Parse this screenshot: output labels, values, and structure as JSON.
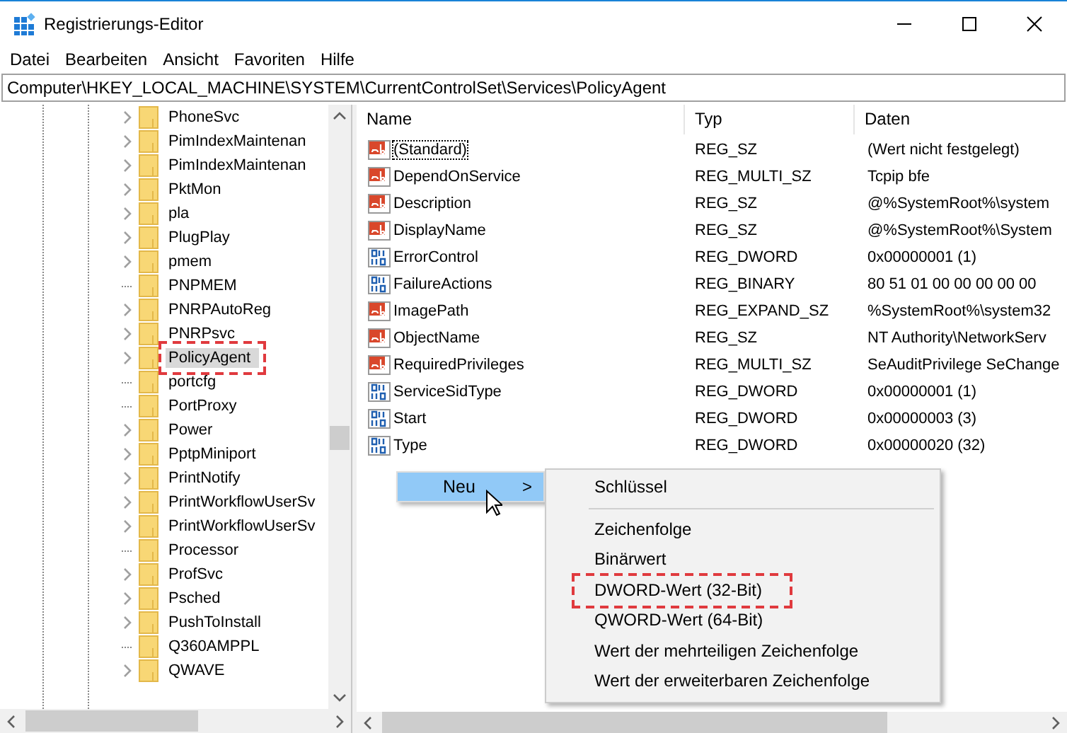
{
  "window": {
    "title": "Registrierungs-Editor"
  },
  "menu": [
    "Datei",
    "Bearbeiten",
    "Ansicht",
    "Favoriten",
    "Hilfe"
  ],
  "address": "Computer\\HKEY_LOCAL_MACHINE\\SYSTEM\\CurrentControlSet\\Services\\PolicyAgent",
  "tree": [
    {
      "label": "PhoneSvc",
      "kind": "arrow",
      "selected": false,
      "marked": false
    },
    {
      "label": "PimIndexMaintenan",
      "kind": "arrow",
      "selected": false,
      "marked": false
    },
    {
      "label": "PimIndexMaintenan",
      "kind": "arrow",
      "selected": false,
      "marked": false
    },
    {
      "label": "PktMon",
      "kind": "arrow",
      "selected": false,
      "marked": false
    },
    {
      "label": "pla",
      "kind": "arrow",
      "selected": false,
      "marked": false
    },
    {
      "label": "PlugPlay",
      "kind": "arrow",
      "selected": false,
      "marked": false
    },
    {
      "label": "pmem",
      "kind": "arrow",
      "selected": false,
      "marked": false
    },
    {
      "label": "PNPMEM",
      "kind": "leaf",
      "selected": false,
      "marked": false
    },
    {
      "label": "PNRPAutoReg",
      "kind": "arrow",
      "selected": false,
      "marked": false
    },
    {
      "label": "PNRPsvc",
      "kind": "arrow",
      "selected": false,
      "marked": false
    },
    {
      "label": "PolicyAgent",
      "kind": "arrow",
      "selected": true,
      "marked": true
    },
    {
      "label": "portcfg",
      "kind": "leaf",
      "selected": false,
      "marked": false
    },
    {
      "label": "PortProxy",
      "kind": "leaf",
      "selected": false,
      "marked": false
    },
    {
      "label": "Power",
      "kind": "arrow",
      "selected": false,
      "marked": false
    },
    {
      "label": "PptpMiniport",
      "kind": "arrow",
      "selected": false,
      "marked": false
    },
    {
      "label": "PrintNotify",
      "kind": "arrow",
      "selected": false,
      "marked": false
    },
    {
      "label": "PrintWorkflowUserSv",
      "kind": "arrow",
      "selected": false,
      "marked": false
    },
    {
      "label": "PrintWorkflowUserSv",
      "kind": "arrow",
      "selected": false,
      "marked": false
    },
    {
      "label": "Processor",
      "kind": "leaf",
      "selected": false,
      "marked": false
    },
    {
      "label": "ProfSvc",
      "kind": "arrow",
      "selected": false,
      "marked": false
    },
    {
      "label": "Psched",
      "kind": "arrow",
      "selected": false,
      "marked": false
    },
    {
      "label": "PushToInstall",
      "kind": "arrow",
      "selected": false,
      "marked": false
    },
    {
      "label": "Q360AMPPL",
      "kind": "leaf",
      "selected": false,
      "marked": false
    },
    {
      "label": "QWAVE",
      "kind": "arrow",
      "selected": false,
      "marked": false
    }
  ],
  "table": {
    "columns": [
      "Name",
      "Typ",
      "Daten"
    ],
    "rows": [
      {
        "kind": "string",
        "name": "(Standard)",
        "type": "REG_SZ",
        "data": "(Wert nicht festgelegt)",
        "focused": true
      },
      {
        "kind": "string",
        "name": "DependOnService",
        "type": "REG_MULTI_SZ",
        "data": "Tcpip bfe",
        "focused": false
      },
      {
        "kind": "string",
        "name": "Description",
        "type": "REG_SZ",
        "data": "@%SystemRoot%\\system",
        "focused": false
      },
      {
        "kind": "string",
        "name": "DisplayName",
        "type": "REG_SZ",
        "data": "@%SystemRoot%\\System",
        "focused": false
      },
      {
        "kind": "binary",
        "name": "ErrorControl",
        "type": "REG_DWORD",
        "data": "0x00000001 (1)",
        "focused": false
      },
      {
        "kind": "binary",
        "name": "FailureActions",
        "type": "REG_BINARY",
        "data": "80 51 01 00 00 00 00 00",
        "focused": false
      },
      {
        "kind": "string",
        "name": "ImagePath",
        "type": "REG_EXPAND_SZ",
        "data": "%SystemRoot%\\system32",
        "focused": false
      },
      {
        "kind": "string",
        "name": "ObjectName",
        "type": "REG_SZ",
        "data": "NT Authority\\NetworkServ",
        "focused": false
      },
      {
        "kind": "string",
        "name": "RequiredPrivileges",
        "type": "REG_MULTI_SZ",
        "data": "SeAuditPrivilege SeChange",
        "focused": false
      },
      {
        "kind": "binary",
        "name": "ServiceSidType",
        "type": "REG_DWORD",
        "data": "0x00000001 (1)",
        "focused": false
      },
      {
        "kind": "binary",
        "name": "Start",
        "type": "REG_DWORD",
        "data": "0x00000003 (3)",
        "focused": false
      },
      {
        "kind": "binary",
        "name": "Type",
        "type": "REG_DWORD",
        "data": "0x00000020 (32)",
        "focused": false
      }
    ]
  },
  "context_menu": {
    "label": "Neu",
    "arrow": ">",
    "selected": true
  },
  "submenu": [
    {
      "kind": "item",
      "label": "Schlüssel",
      "marked": false
    },
    {
      "kind": "separator"
    },
    {
      "kind": "item",
      "label": "Zeichenfolge",
      "marked": false
    },
    {
      "kind": "item",
      "label": "Binärwert",
      "marked": false
    },
    {
      "kind": "item",
      "label": "DWORD-Wert (32-Bit)",
      "marked": true
    },
    {
      "kind": "item",
      "label": "QWORD-Wert (64-Bit)",
      "marked": false
    },
    {
      "kind": "item",
      "label": "Wert der mehrteiligen Zeichenfolge",
      "marked": false
    },
    {
      "kind": "item",
      "label": "Wert der erweiterbaren Zeichenfolge",
      "marked": false
    }
  ]
}
